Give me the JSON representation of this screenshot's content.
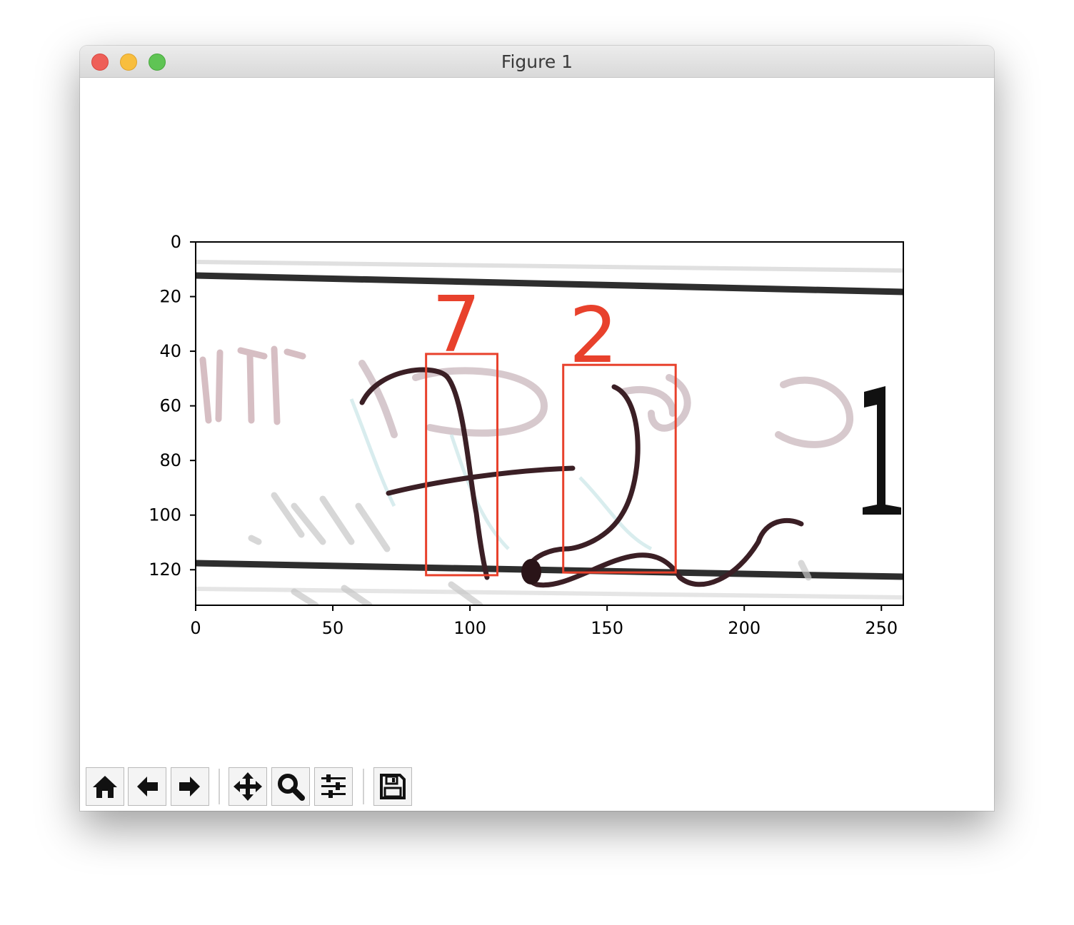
{
  "window": {
    "title": "Figure 1"
  },
  "toolbar": {
    "buttons": [
      {
        "name": "home",
        "icon": "home-icon"
      },
      {
        "name": "back",
        "icon": "arrow-left-icon"
      },
      {
        "name": "forward",
        "icon": "arrow-right-icon"
      },
      {
        "name": "pan",
        "icon": "move-icon"
      },
      {
        "name": "zoom",
        "icon": "magnifier-icon"
      },
      {
        "name": "configure-subplots",
        "icon": "sliders-icon"
      },
      {
        "name": "save",
        "icon": "floppy-disk-icon"
      }
    ]
  },
  "chart_data": {
    "type": "image",
    "xlim": [
      0,
      258
    ],
    "ylim": [
      133,
      0
    ],
    "xticks": [
      0,
      50,
      100,
      150,
      200,
      250
    ],
    "yticks": [
      0,
      20,
      40,
      60,
      80,
      100,
      120
    ],
    "grid": false,
    "boxes": [
      {
        "label": "7",
        "x0": 84,
        "y0": 41,
        "x1": 110,
        "y1": 122,
        "color": "#e8412c"
      },
      {
        "label": "2",
        "x0": 134,
        "y0": 45,
        "x1": 175,
        "y1": 121,
        "color": "#e8412c"
      }
    ]
  }
}
